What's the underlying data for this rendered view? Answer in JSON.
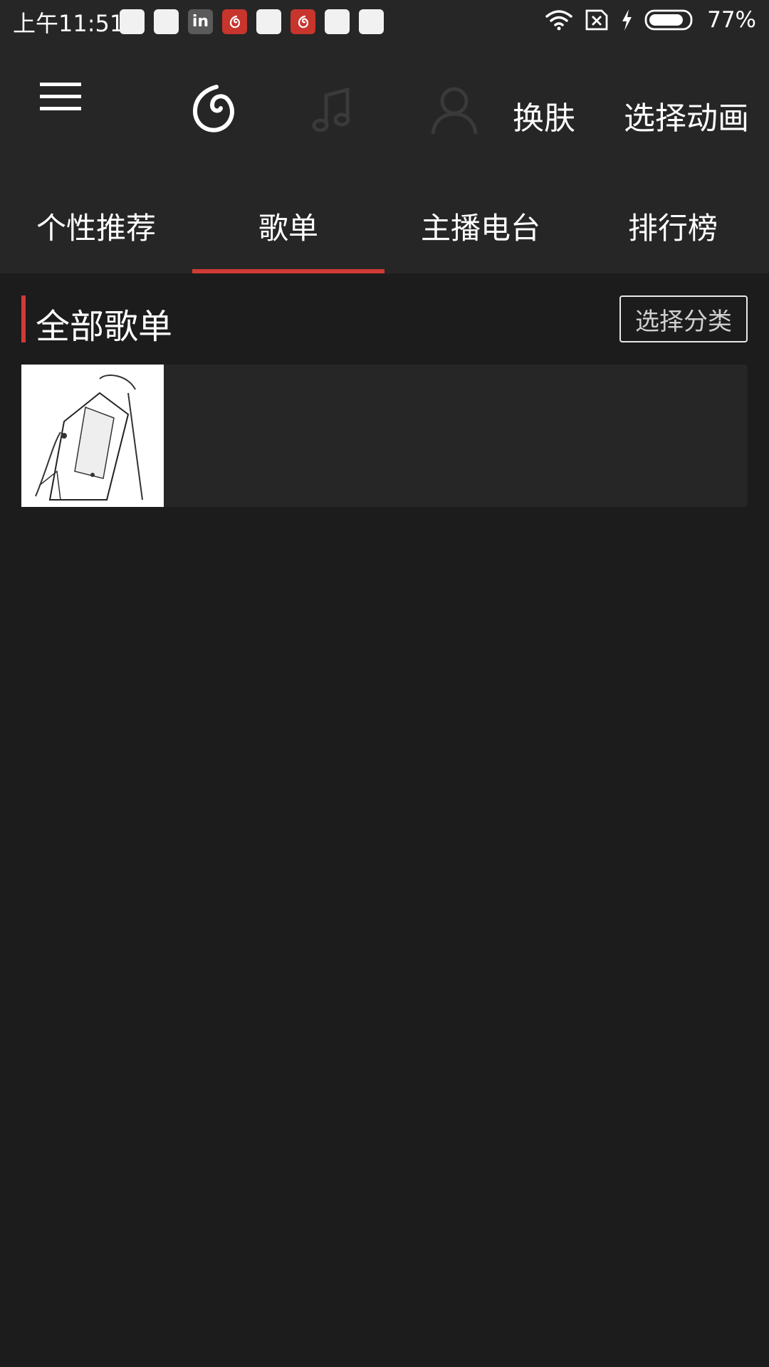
{
  "status_bar": {
    "time": "上午11:51",
    "notification_icons": [
      "app-icon",
      "app-icon",
      "linkedin-icon",
      "netease-music-icon",
      "app-icon",
      "netease-music-icon",
      "app-icon",
      "app-icon"
    ],
    "battery_percent": "77%"
  },
  "header": {
    "menu_icon": "hamburger-menu-icon",
    "nav_icons": [
      "netease-music-logo-icon",
      "music-note-icon",
      "user-icon"
    ],
    "skin_button": "换肤",
    "animation_button": "选择动画"
  },
  "tabs": [
    {
      "label": "个性推荐",
      "active": false
    },
    {
      "label": "歌单",
      "active": true
    },
    {
      "label": "主播电台",
      "active": false
    },
    {
      "label": "排行榜",
      "active": false
    }
  ],
  "section": {
    "title": "全部歌单",
    "category_button": "选择分类"
  },
  "colors": {
    "accent": "#d03b35",
    "bar_background": "#262626",
    "page_background": "#1c1c1c"
  }
}
